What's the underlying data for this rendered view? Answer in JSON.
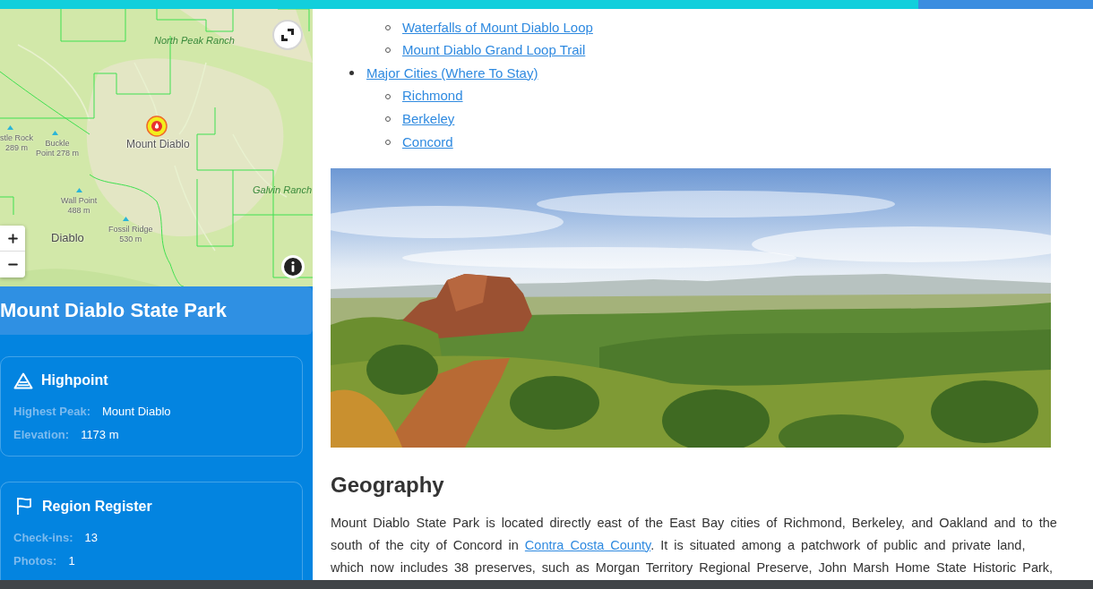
{
  "progress_bar": {
    "level": 0.84
  },
  "map": {
    "labels": [
      {
        "kind": "ranch",
        "lines": [
          "North Peak Ranch"
        ]
      },
      {
        "kind": "peak",
        "lines": [
          "stle Rock",
          "289 m"
        ]
      },
      {
        "kind": "peak",
        "lines": [
          "Buckle",
          "Point 278 m"
        ]
      },
      {
        "kind": "summit",
        "lines": [
          "Mount Diablo"
        ]
      },
      {
        "kind": "ranch",
        "lines": [
          "Galvin Ranch"
        ]
      },
      {
        "kind": "peak",
        "lines": [
          "Wall Point",
          "488 m"
        ]
      },
      {
        "kind": "town",
        "lines": [
          "Diablo"
        ]
      },
      {
        "kind": "peak",
        "lines": [
          "Fossil Ridge",
          "530 m"
        ]
      }
    ]
  },
  "sidebar": {
    "title": "Mount Diablo State Park",
    "cards": [
      {
        "kind": "highpoint",
        "title": "Highpoint",
        "rows": [
          {
            "label": "Highest Peak:",
            "value": "Mount Diablo"
          },
          {
            "label": "Elevation:",
            "value": "1173 m"
          }
        ]
      },
      {
        "kind": "register",
        "title": "Region Register",
        "rows": [
          {
            "label": "Check-ins:",
            "value": "13"
          },
          {
            "label": "Photos:",
            "value": "1"
          }
        ]
      }
    ]
  },
  "toc": {
    "continued_items": [
      {
        "text": "Waterfalls of Mount Diablo Loop"
      },
      {
        "text": "Mount Diablo Grand Loop Trail"
      }
    ],
    "items": [
      {
        "text": "Major Cities (Where To Stay)",
        "children": [
          {
            "text": "Richmond"
          },
          {
            "text": "Berkeley"
          },
          {
            "text": "Concord"
          }
        ]
      }
    ]
  },
  "article": {
    "heading": "Geography",
    "paragraph": [
      {
        "kind": "text",
        "text": "Mount Diablo State Park is located directly east of the East Bay cities of Richmond, Berkeley, and Oakland and to the south of the city of Concord in "
      },
      {
        "kind": "link",
        "text": "Contra Costa County"
      },
      {
        "kind": "text",
        "text": ". It is situated among a patchwork of public and private land, which now includes 38 preserves, such as Morgan Territory Regional Preserve, John Marsh Home State Historic Park,"
      }
    ]
  }
}
